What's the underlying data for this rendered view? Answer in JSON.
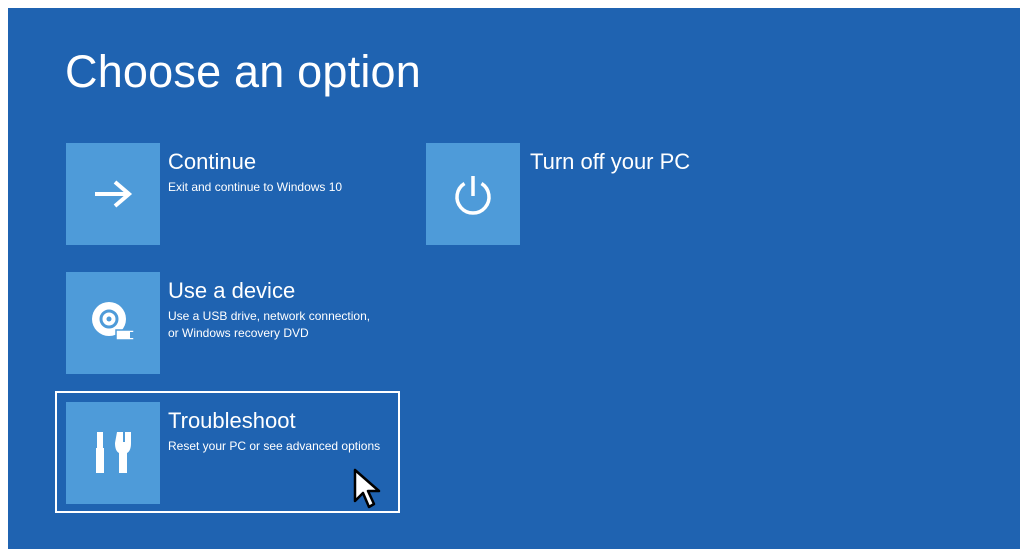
{
  "title": "Choose an option",
  "options": [
    {
      "label": "Continue",
      "description": "Exit and continue to Windows 10",
      "icon": "arrow-right-icon"
    },
    {
      "label": "Turn off your PC",
      "description": "",
      "icon": "power-icon"
    },
    {
      "label": "Use a device",
      "description_line1": "Use a USB drive, network connection,",
      "description_line2": "or Windows recovery DVD",
      "icon": "disc-usb-icon"
    },
    {
      "label": "Troubleshoot",
      "description": "Reset your PC or see advanced options",
      "icon": "tools-icon"
    }
  ],
  "selected_option": "Troubleshoot",
  "colors": {
    "background": "#1f63b1",
    "tile": "#4e9bd9",
    "text": "#ffffff"
  }
}
